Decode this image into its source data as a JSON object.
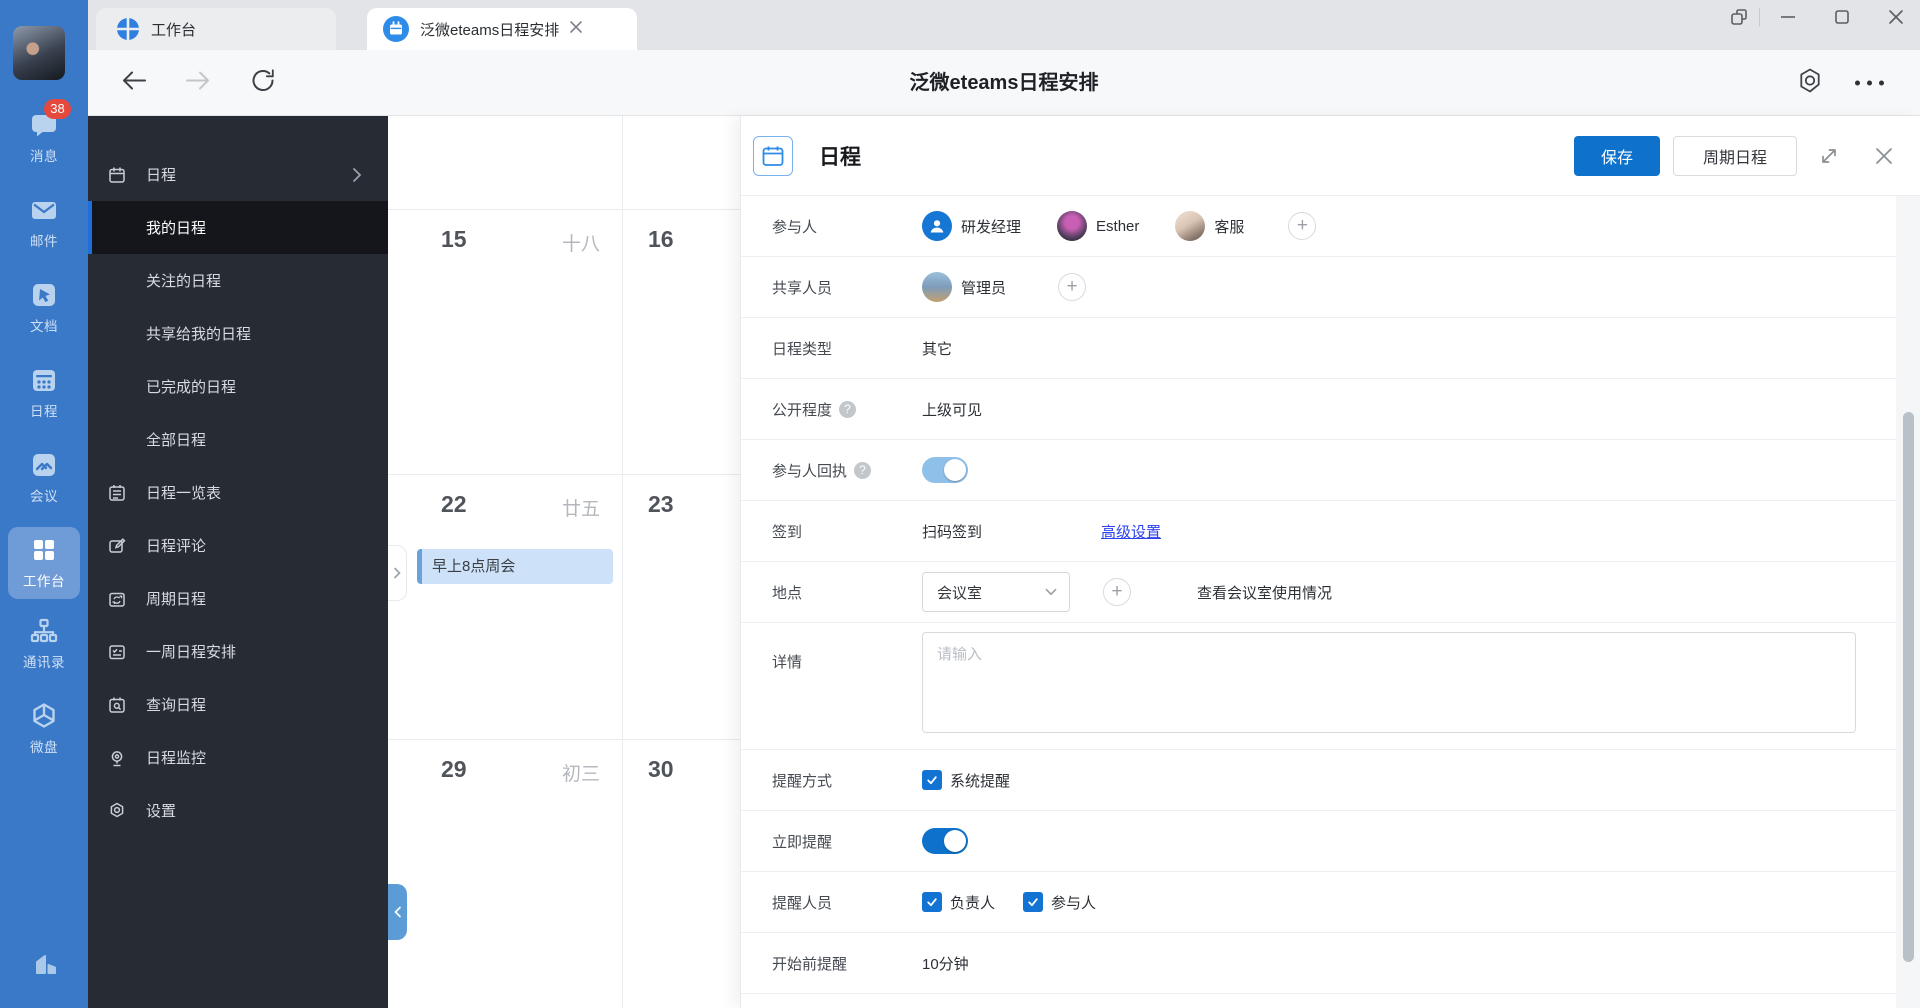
{
  "icons": {
    "plus": "+",
    "question": "?"
  },
  "tabs": {
    "tab1": "工作台",
    "tab2": "泛微eteams日程安排"
  },
  "navbar": {
    "title": "泛微eteams日程安排"
  },
  "rail": {
    "badge": "38",
    "items": [
      {
        "label": "消息"
      },
      {
        "label": "邮件"
      },
      {
        "label": "文档"
      },
      {
        "label": "日程"
      },
      {
        "label": "会议"
      },
      {
        "label": "工作台"
      },
      {
        "label": "通讯录"
      },
      {
        "label": "微盘"
      }
    ]
  },
  "sidebar": {
    "items": [
      {
        "label": "日程"
      },
      {
        "label": "我的日程"
      },
      {
        "label": "关注的日程"
      },
      {
        "label": "共享给我的日程"
      },
      {
        "label": "已完成的日程"
      },
      {
        "label": "全部日程"
      },
      {
        "label": "日程一览表"
      },
      {
        "label": "日程评论"
      },
      {
        "label": "周期日程"
      },
      {
        "label": "一周日程安排"
      },
      {
        "label": "查询日程"
      },
      {
        "label": "日程监控"
      },
      {
        "label": "设置"
      }
    ]
  },
  "calendar": {
    "row2": {
      "day1": "15",
      "lunar1": "十八",
      "day2": "16"
    },
    "row3": {
      "day1": "22",
      "lunar1": "廿五",
      "day2": "23",
      "event": "早上8点周会"
    },
    "row4": {
      "day1": "29",
      "lunar1": "初三",
      "day2": "30"
    }
  },
  "panel": {
    "title": "日程",
    "save": "保存",
    "recurring": "周期日程",
    "participants": {
      "label": "参与人",
      "p1": "研发经理",
      "p2": "Esther",
      "p3": "客服"
    },
    "shared": {
      "label": "共享人员",
      "p1": "管理员"
    },
    "type": {
      "label": "日程类型",
      "value": "其它"
    },
    "visibility": {
      "label": "公开程度",
      "value": "上级可见"
    },
    "receipt": {
      "label": "参与人回执"
    },
    "checkin": {
      "label": "签到",
      "value": "扫码签到",
      "link": "高级设置"
    },
    "location": {
      "label": "地点",
      "select": "会议室",
      "extra": "查看会议室使用情况"
    },
    "details": {
      "label": "详情",
      "placeholder": "请输入"
    },
    "remind_method": {
      "label": "提醒方式",
      "cb1": "系统提醒"
    },
    "remind_now": {
      "label": "立即提醒"
    },
    "remind_people": {
      "label": "提醒人员",
      "cb1": "负责人",
      "cb2": "参与人"
    },
    "remind_before": {
      "label": "开始前提醒",
      "value": "10分钟"
    }
  },
  "colors": {
    "accent": "#0e72cc",
    "rail_blue": "#3a78c8",
    "link_blue": "#2c41ee",
    "badge_red": "#e5493d"
  }
}
